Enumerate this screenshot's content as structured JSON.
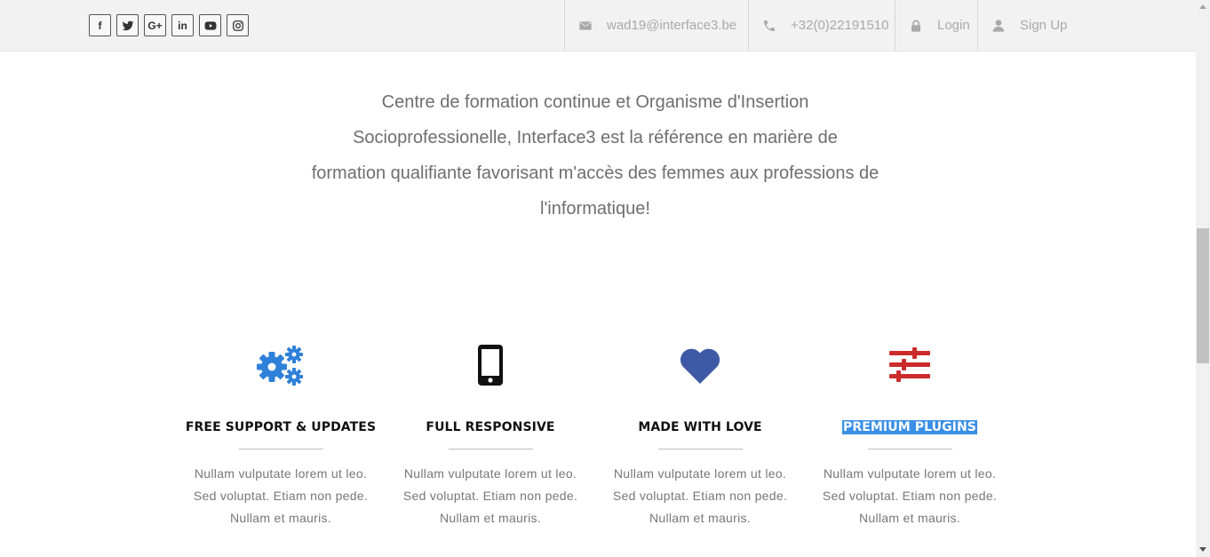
{
  "topbar": {
    "social": [
      {
        "icon": "facebook-icon",
        "label": "f"
      },
      {
        "icon": "twitter-icon",
        "label": ""
      },
      {
        "icon": "google-plus-icon",
        "label": "G+"
      },
      {
        "icon": "linkedin-icon",
        "label": "in"
      },
      {
        "icon": "youtube-icon",
        "label": ""
      },
      {
        "icon": "instagram-icon",
        "label": ""
      }
    ],
    "email": {
      "icon": "envelope-icon",
      "text": "wad19@interface3.be"
    },
    "phone": {
      "icon": "phone-icon",
      "text": "+32(0)22191510"
    },
    "login": {
      "icon": "lock-icon",
      "text": "Login"
    },
    "signup": {
      "icon": "user-icon",
      "text": "Sign Up"
    }
  },
  "intro": {
    "lines": [
      "Centre de formation continue et Organisme d'Insertion",
      "Socioprofessionelle, Interface3 est la référence en marière de",
      "formation qualifiante favorisant m'accès des femmes aux professions de",
      "l'informatique!"
    ]
  },
  "features": [
    {
      "icon": "gears-icon",
      "color": "#2f80d9",
      "title": "FREE SUPPORT & UPDATES",
      "highlighted": false,
      "lines": [
        "Nullam vulputate lorem ut leo.",
        "Sed voluptat. Etiam non pede.",
        "Nullam et mauris."
      ]
    },
    {
      "icon": "mobile-phone-icon",
      "color": "#111111",
      "title": "FULL RESPONSIVE",
      "highlighted": false,
      "lines": [
        "Nullam vulputate lorem ut leo.",
        "Sed voluptat. Etiam non pede.",
        "Nullam et mauris."
      ]
    },
    {
      "icon": "heart-icon",
      "color": "#3e5aa6",
      "title": "MADE WITH LOVE",
      "highlighted": false,
      "lines": [
        "Nullam vulputate lorem ut leo.",
        "Sed voluptat. Etiam non pede.",
        "Nullam et mauris."
      ]
    },
    {
      "icon": "sliders-icon",
      "color": "#cc2b2b",
      "title": "PREMIUM PLUGINS",
      "highlighted": true,
      "lines": [
        "Nullam vulputate lorem ut leo.",
        "Sed voluptat. Etiam non pede.",
        "Nullam et mauris."
      ]
    }
  ]
}
